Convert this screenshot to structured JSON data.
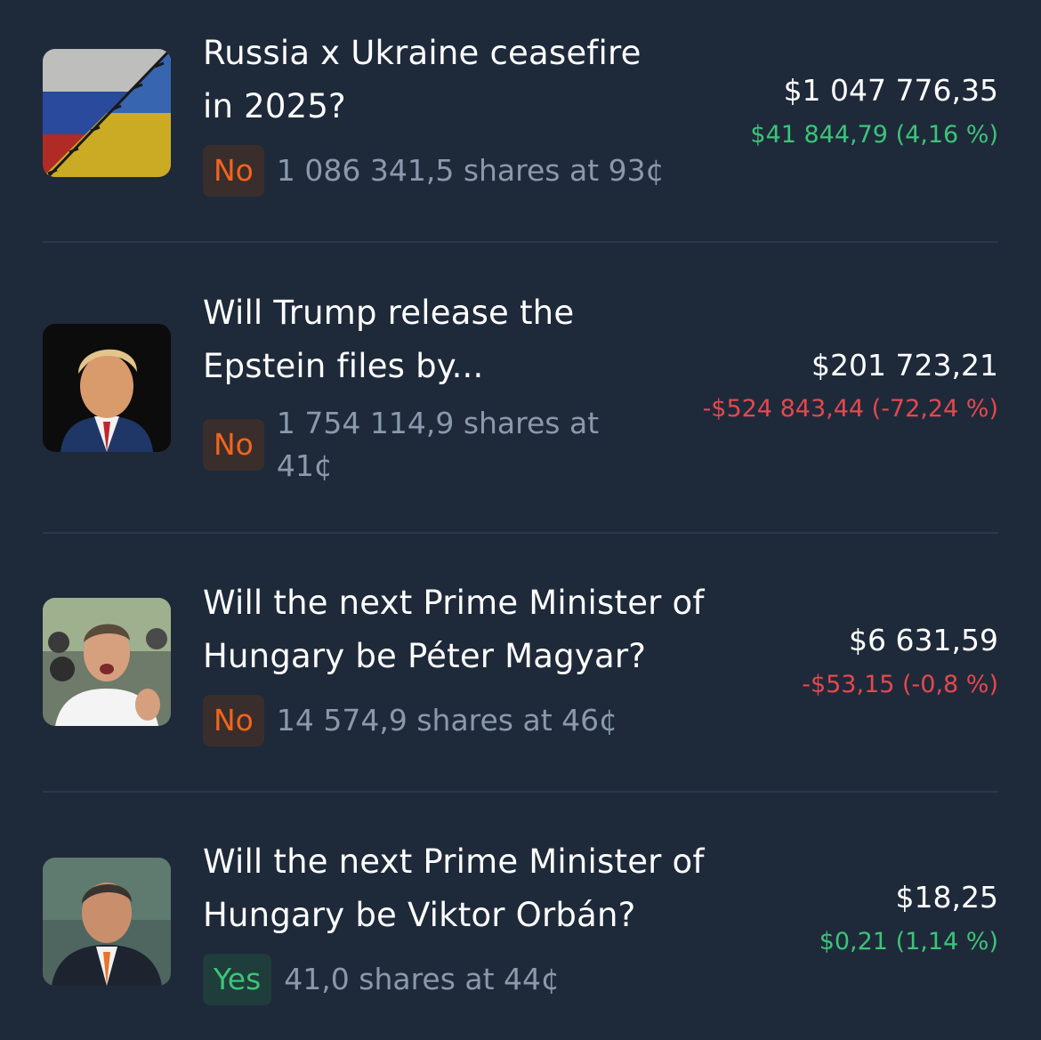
{
  "colors": {
    "background": "#1e2a3a",
    "title": "#ffffff",
    "shares": "#8a99ab",
    "no": "#f2641e",
    "yes": "#3cc479",
    "positive": "#3cc479",
    "negative": "#e5484d"
  },
  "positions": [
    {
      "title_lines": [
        "Russia x Ukraine ceasefire",
        "in 2025?"
      ],
      "outcome": "No",
      "shares_text": "1 086 341,5 shares at 93¢",
      "value": "$1 047 776,35",
      "pnl": "$41 844,79 (4,16 %)",
      "pnl_sign": "positive",
      "icon": "russia-ukraine-flag-image"
    },
    {
      "title_lines": [
        "Will Trump release the",
        "Epstein files by..."
      ],
      "outcome": "No",
      "shares_text": "1 754 114,9 shares at 41¢",
      "value": "$201 723,21",
      "pnl": "-$524 843,44 (-72,24 %)",
      "pnl_sign": "negative",
      "icon": "trump-portrait-image"
    },
    {
      "title_lines": [
        "Will the next Prime Minister of",
        "Hungary be Péter Magyar?"
      ],
      "outcome": "No",
      "shares_text": "14 574,9 shares at 46¢",
      "value": "$6 631,59",
      "pnl": "-$53,15 (-0,8 %)",
      "pnl_sign": "negative",
      "icon": "magyar-portrait-image"
    },
    {
      "title_lines": [
        "Will the next Prime Minister of",
        "Hungary be Viktor Orbán?"
      ],
      "outcome": "Yes",
      "shares_text": "41,0 shares at 44¢",
      "value": "$18,25",
      "pnl": "$0,21 (1,14 %)",
      "pnl_sign": "positive",
      "icon": "orban-portrait-image"
    }
  ]
}
